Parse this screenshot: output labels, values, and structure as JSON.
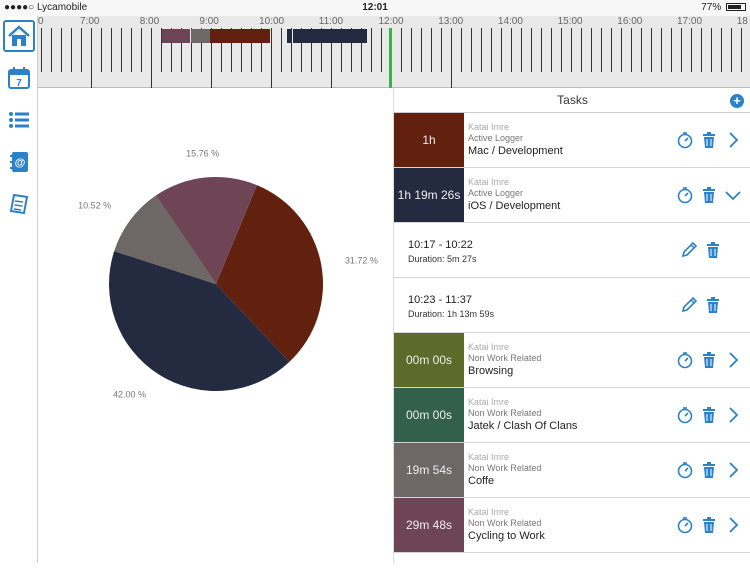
{
  "status_bar": {
    "carrier": "●●●●○ Lycamobile",
    "time": "12:01",
    "battery": "77%"
  },
  "timeline": {
    "hours": [
      "0",
      "7:00",
      "8:00",
      "9:00",
      "10:00",
      "11:00",
      "12:00",
      "13:00",
      "14:00",
      "15:00",
      "16:00",
      "17:00",
      "18"
    ],
    "blocks": [
      {
        "start": "8:11",
        "end": "8:40",
        "color": "#6e4555"
      },
      {
        "start": "8:40",
        "end": "9:00",
        "color": "#6d6866"
      },
      {
        "start": "9:00",
        "end": "10:00",
        "color": "#62200f"
      },
      {
        "start": "10:17",
        "end": "10:22",
        "color": "#242a40"
      },
      {
        "start": "10:23",
        "end": "11:37",
        "color": "#242a40"
      }
    ],
    "now": "12:01",
    "now_color": "#3bb34a"
  },
  "sidebar": {
    "items": [
      {
        "name": "home-icon",
        "active": true
      },
      {
        "name": "calendar-icon",
        "label": "7"
      },
      {
        "name": "list-icon"
      },
      {
        "name": "contacts-icon"
      },
      {
        "name": "report-icon"
      }
    ]
  },
  "chart_data": {
    "type": "pie",
    "slices": [
      {
        "value": 31.72,
        "label": "31.72 %",
        "color": "#62200f"
      },
      {
        "value": 42.0,
        "label": "42.00 %",
        "color": "#242a40"
      },
      {
        "value": 10.52,
        "label": "10.52 %",
        "color": "#6d6866"
      },
      {
        "value": 15.76,
        "label": "15.76 %",
        "color": "#6e4555"
      }
    ]
  },
  "tasks": {
    "title": "Tasks",
    "add_label": "+",
    "rows": [
      {
        "type": "task",
        "swatch_text": "1h",
        "color": "#62200f",
        "user": "Katai Imre",
        "category": "Active Logger",
        "name": "Mac / Development",
        "chevron": "right"
      },
      {
        "type": "task",
        "swatch_text": "1h 19m 26s",
        "color": "#242a40",
        "user": "Katai Imre",
        "category": "Active Logger",
        "name": "iOS / Development",
        "chevron": "down"
      },
      {
        "type": "entry",
        "range": "10:17 - 10:22",
        "duration": "Duration: 5m 27s"
      },
      {
        "type": "entry",
        "range": "10:23 - 11:37",
        "duration": "Duration: 1h 13m 59s"
      },
      {
        "type": "task",
        "swatch_text": "00m 00s",
        "color": "#5d6a2a",
        "user": "Katai Imre",
        "category": "Non Work Related",
        "name": "Browsing",
        "chevron": "right"
      },
      {
        "type": "task",
        "swatch_text": "00m 00s",
        "color": "#33604a",
        "user": "Katai Imre",
        "category": "Non Work Related",
        "name": "Jatek / Clash Of Clans",
        "chevron": "right"
      },
      {
        "type": "task",
        "swatch_text": "19m 54s",
        "color": "#6d6866",
        "user": "Katai Imre",
        "category": "Non Work Related",
        "name": "Coffe",
        "chevron": "right"
      },
      {
        "type": "task",
        "swatch_text": "29m 48s",
        "color": "#6e4555",
        "user": "Katai Imre",
        "category": "Non Work Related",
        "name": "Cycling to Work",
        "chevron": "right"
      }
    ]
  }
}
